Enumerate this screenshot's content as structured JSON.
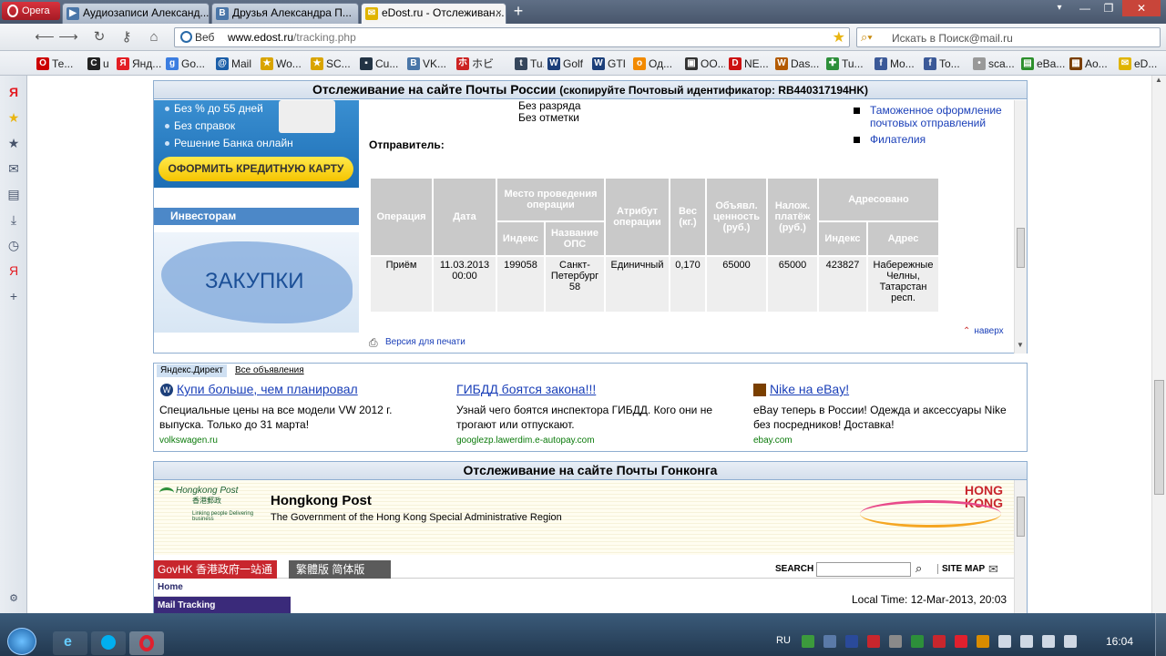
{
  "browser": {
    "menu_label": "Opera",
    "tabs": [
      {
        "label": "Аудиозаписи Александ...",
        "color": "#4a76a8",
        "icon": "▶"
      },
      {
        "label": "Друзья Александра П...",
        "color": "#4a76a8",
        "icon": "B"
      },
      {
        "label": "eDost.ru - Отслеживан...",
        "color": "#e0b400",
        "icon": "✉"
      }
    ],
    "new_tab": "+",
    "window_controls": {
      "min": "—",
      "max": "❐",
      "close": "✕"
    }
  },
  "addressbar": {
    "badge": "Веб",
    "url_host": "www.edost.ru",
    "url_path": "/tracking.php",
    "search_placeholder": "Искать в Поиск@mail.ru"
  },
  "bookmarks": [
    {
      "label": "Те...",
      "color": "#cc0000",
      "icon": "O"
    },
    {
      "label": "u",
      "color": "#222222",
      "icon": "C"
    },
    {
      "label": "Янд...",
      "color": "#e31e24",
      "icon": "Я"
    },
    {
      "label": "Go...",
      "color": "#3b7de0",
      "icon": "g"
    },
    {
      "label": "Mail",
      "color": "#1b5ea8",
      "icon": "@"
    },
    {
      "label": "Wo...",
      "color": "#d9a400",
      "icon": "★"
    },
    {
      "label": "SC...",
      "color": "#d9a400",
      "icon": "★"
    },
    {
      "label": "Cu...",
      "color": "#234",
      "icon": "▪"
    },
    {
      "label": "VK...",
      "color": "#4a76a8",
      "icon": "B"
    },
    {
      "label": "ホビ",
      "color": "#cc2222",
      "icon": "ホ"
    },
    {
      "label": "Tu...",
      "color": "#35465c",
      "icon": "t"
    },
    {
      "label": "Golf",
      "color": "#1c3f7a",
      "icon": "W"
    },
    {
      "label": "GTI",
      "color": "#1c3f7a",
      "icon": "W"
    },
    {
      "label": "Од...",
      "color": "#f28a00",
      "icon": "о"
    },
    {
      "label": "OO...",
      "color": "#333333",
      "icon": "▣"
    },
    {
      "label": "NE...",
      "color": "#cc1111",
      "icon": "D"
    },
    {
      "label": "Das...",
      "color": "#b35a00",
      "icon": "W"
    },
    {
      "label": "Tu...",
      "color": "#2d8f3a",
      "icon": "✚"
    },
    {
      "label": "Mo...",
      "color": "#3b5998",
      "icon": "f"
    },
    {
      "label": "To...",
      "color": "#3b5998",
      "icon": "f"
    },
    {
      "label": "sca...",
      "color": "#999999",
      "icon": "•"
    },
    {
      "label": "eBa...",
      "color": "#2c8f2c",
      "icon": "▤"
    },
    {
      "label": "Ao...",
      "color": "#7a3f00",
      "icon": "▦"
    },
    {
      "label": "eD...",
      "color": "#e0b400",
      "icon": "✉"
    }
  ],
  "russia_post": {
    "title": "Отслеживание на сайте Почты России",
    "subtitle": "(скопируйте Почтовый идентификатор: RB440317194HK)",
    "ad": {
      "bullets": [
        "Без % до 55 дней",
        "Без справок",
        "Решение Банка онлайн"
      ],
      "button": "ОФОРМИТЬ КРЕДИТНУЮ КАРТУ"
    },
    "investors": "Инвесторам",
    "purchases": "ЗАКУПКИ",
    "text_line1": "Без разряда",
    "text_line2": "Без отметки",
    "sender_label": "Отправитель:",
    "links": [
      "Таможенное оформление почтовых отправлений",
      "Филателия"
    ],
    "table": {
      "headers": {
        "operation": "Операция",
        "date": "Дата",
        "place": "Место проведения операции",
        "place_index": "Индекс",
        "place_name": "Название ОПС",
        "attribute": "Атрибут операции",
        "weight": "Вес (кг.)",
        "declared": "Объявл. ценность (руб.)",
        "cod": "Налож. платёж (руб.)",
        "addressed": "Адресовано",
        "addr_index": "Индекс",
        "addr_address": "Адрес"
      },
      "row": {
        "operation": "Приём",
        "date": "11.03.2013 00:00",
        "place_index": "199058",
        "place_name": "Санкт-Петербург 58",
        "attribute": "Единичный",
        "weight": "0,170",
        "declared": "65000",
        "cod": "65000",
        "addr_index": "423827",
        "addr_address": "Набережные Челны, Татарстан респ."
      }
    },
    "print_version": "Версия для печати",
    "back_top": "наверх"
  },
  "yandex_direct": {
    "label": "Яндекс.Директ",
    "all_ads": "Все объявления",
    "ads": [
      {
        "title": "Купи больше, чем планировал",
        "text": "Специальные цены на все модели VW 2012 г. выпуска. Только до 31 марта!",
        "url": "volkswagen.ru"
      },
      {
        "title": "ГИБДД боятся закона!!!",
        "text": "Узнай чего боятся инспектора ГИБДД. Кого они не трогают или отпускают.",
        "url": "googlezp.lawerdim.e-autopay.com"
      },
      {
        "title": "Nike на eBay!",
        "text": "eBay теперь в России! Одежда и аксессуары Nike без посредников! Доставка!",
        "url": "ebay.com"
      }
    ]
  },
  "hongkong": {
    "title": "Отслеживание на сайте Почты Гонконга",
    "brand": "Hongkong Post",
    "brand_sub": "The Government of the Hong Kong Special Administrative Region",
    "logo_text": "Hongkong Post",
    "logo_cn": "香港郵政",
    "logo_tag": "Linking people Delivering business",
    "hk_brand": "HONG KONG",
    "govhk": "GovHK 香港政府一站通",
    "lang": "繁體版  简体版",
    "search_label": "SEARCH",
    "sitemap": "SITE MAP",
    "menu": [
      "Home",
      "Mail Tracking"
    ],
    "local_time": "Local Time: 12-Mar-2013, 20:03"
  },
  "taskbar": {
    "lang": "RU",
    "clock": "16:04"
  }
}
